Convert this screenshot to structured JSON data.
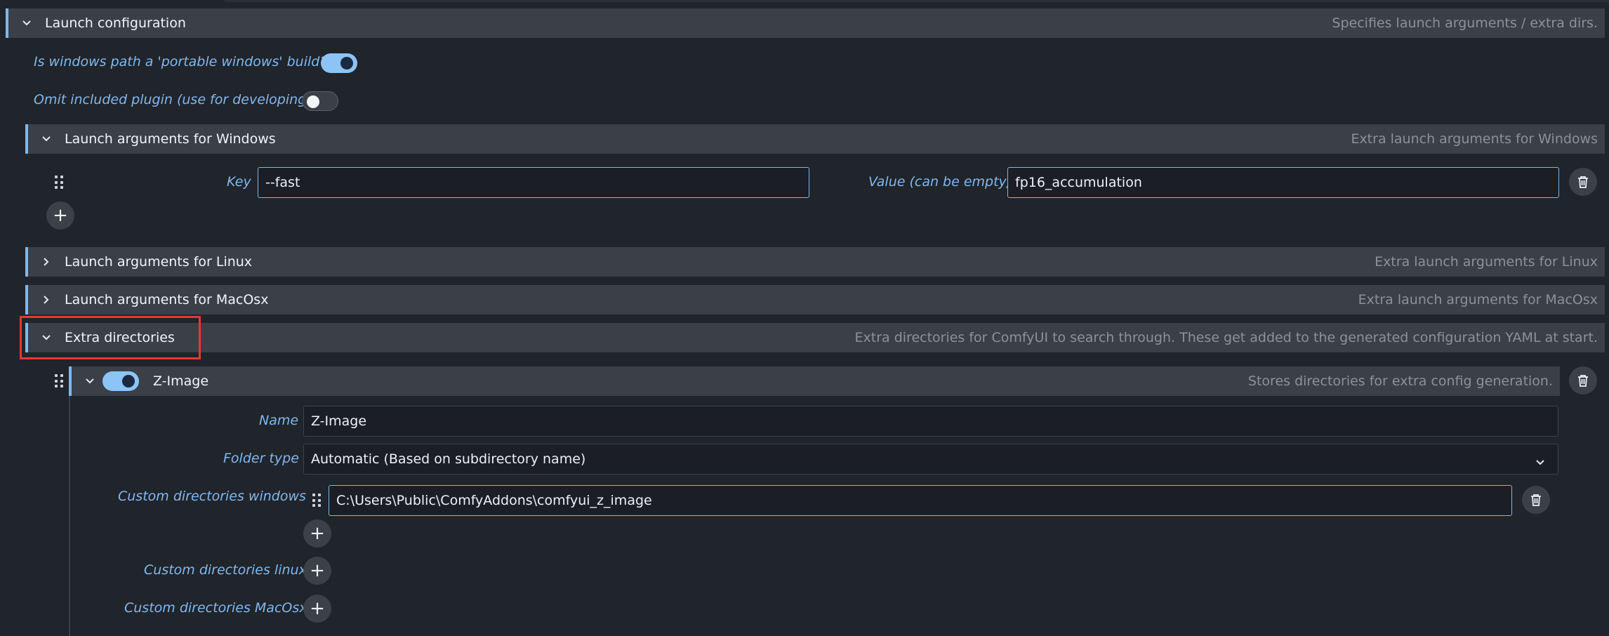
{
  "launch_config": {
    "title": "Launch configuration",
    "description": "Specifies launch arguments / extra dirs.",
    "portable_windows": {
      "label": "Is windows path a 'portable windows' build?",
      "enabled": true
    },
    "omit_plugin": {
      "label": "Omit included plugin (use for developing)",
      "enabled": false
    }
  },
  "windows_args": {
    "title": "Launch arguments for Windows",
    "description": "Extra launch arguments for Windows",
    "key_label": "Key",
    "key_value": "--fast",
    "value_label": "Value (can be empty)",
    "value_value": "fp16_accumulation",
    "add_label": "+"
  },
  "linux_args": {
    "title": "Launch arguments for Linux",
    "description": "Extra launch arguments for Linux"
  },
  "macosx_args": {
    "title": "Launch arguments for MacOsx",
    "description": "Extra launch arguments for MacOsx"
  },
  "extra_dirs": {
    "title": "Extra directories",
    "description": "Extra directories for ComfyUI to search through. These get added to the generated configuration YAML at start.",
    "item": {
      "title": "Z-Image",
      "enabled": true,
      "description": "Stores directories for extra config generation.",
      "name_label": "Name",
      "name_value": "Z-Image",
      "folder_type_label": "Folder type",
      "folder_type_value": "Automatic (Based on subdirectory name)",
      "windows_label": "Custom directories windows",
      "windows_value": "C:\\Users\\Public\\ComfyAddons\\comfyui_z_image",
      "linux_label": "Custom directories linux",
      "macosx_label": "Custom directories MacOsx",
      "add_label": "+"
    }
  },
  "colors": {
    "accent": "#7fb8ef",
    "label": "#82b8ee",
    "highlight": "#e53935"
  }
}
